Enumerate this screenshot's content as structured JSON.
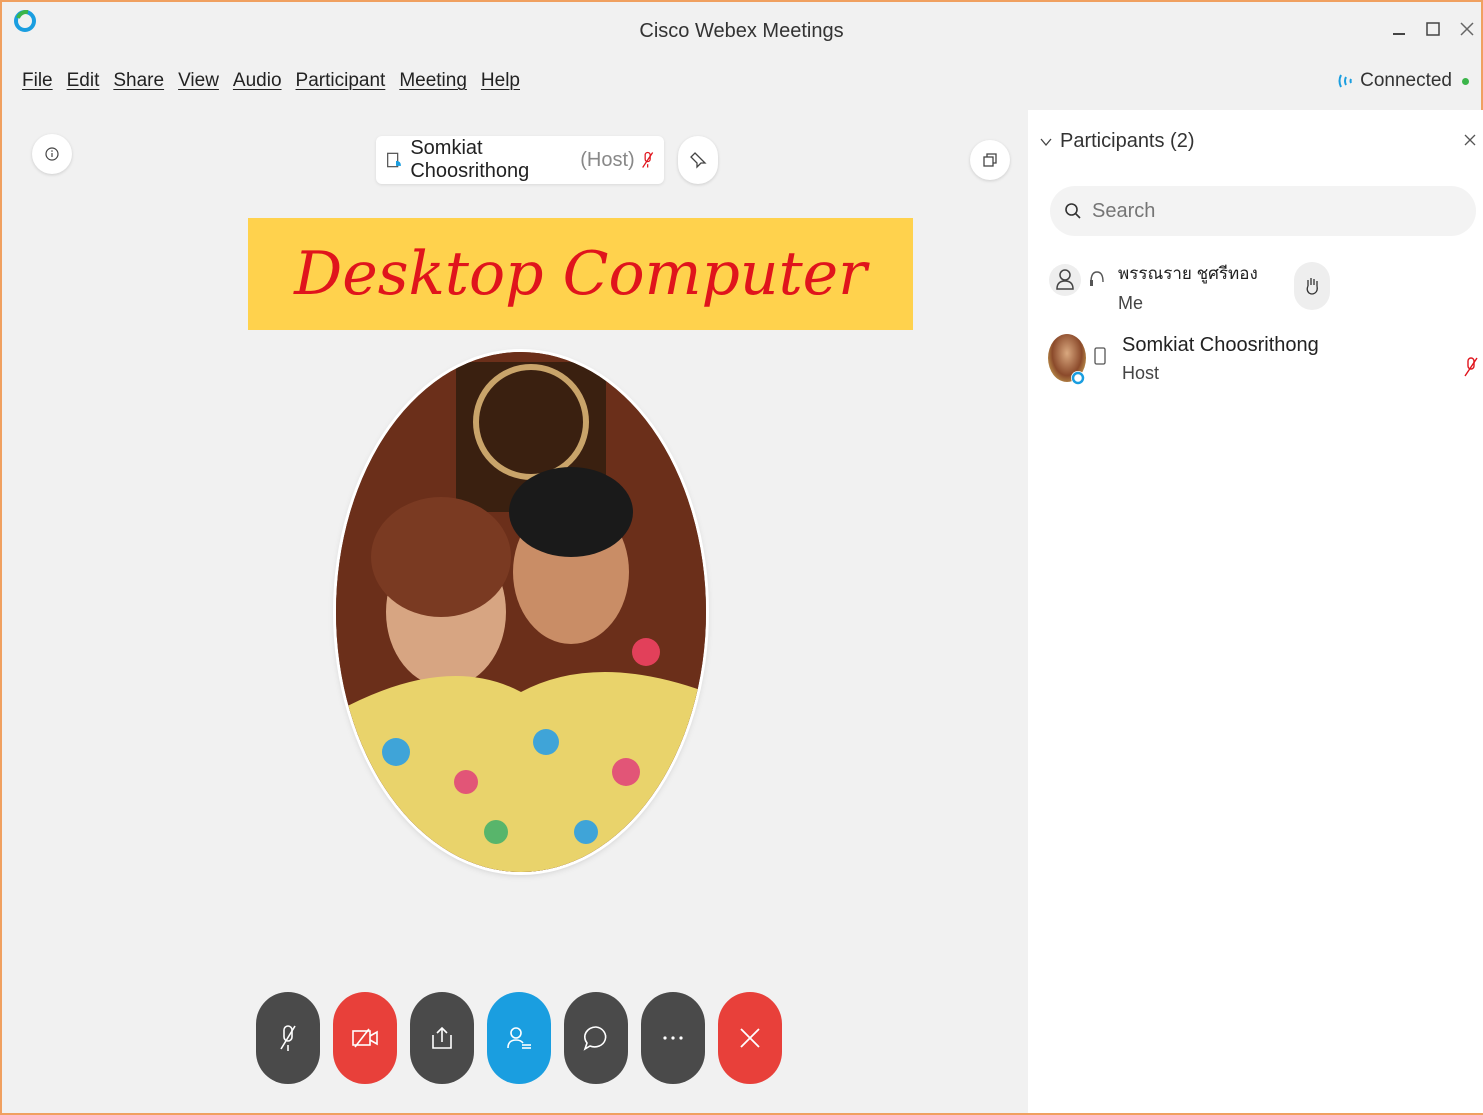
{
  "window": {
    "title": "Cisco Webex Meetings"
  },
  "menu": [
    "File",
    "Edit",
    "Share",
    "View",
    "Audio",
    "Participant",
    "Meeting",
    "Help"
  ],
  "status": {
    "text": "Connected"
  },
  "stage": {
    "active_speaker": "Somkiat Choosrithong",
    "active_speaker_role": "(Host)",
    "banner_text": "Desktop Computer"
  },
  "controls": [
    {
      "name": "mute-button",
      "icon": "microphone-muted-icon"
    },
    {
      "name": "stop-video-button",
      "icon": "video-off-icon"
    },
    {
      "name": "share-button",
      "icon": "share-icon"
    },
    {
      "name": "participants-button",
      "icon": "participants-icon"
    },
    {
      "name": "chat-button",
      "icon": "chat-icon"
    },
    {
      "name": "more-options-button",
      "icon": "more-icon"
    },
    {
      "name": "leave-meeting-button",
      "icon": "close-icon"
    }
  ],
  "panel": {
    "title": "Participants (2)",
    "search_placeholder": "Search",
    "participants": [
      {
        "name": "พรรณราย ชูศรีทอง",
        "sub": "Me"
      },
      {
        "name": "Somkiat Choosrithong",
        "sub": "Host"
      }
    ]
  },
  "colors": {
    "accent": "#1a9ee0",
    "danger": "#e8403a",
    "banner": "#ffd24d",
    "banner_text": "#e0141c"
  }
}
